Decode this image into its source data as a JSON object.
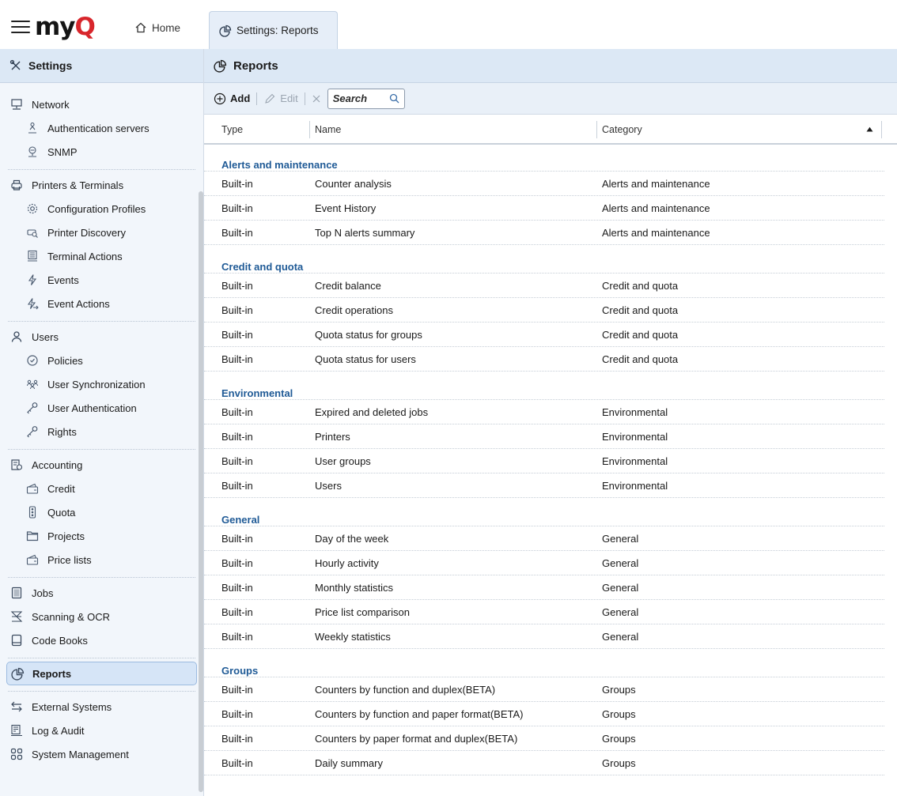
{
  "app": {
    "logo_text": "my",
    "logo_accent": "Q",
    "home_label": "Home",
    "tab_label": "Settings: Reports",
    "brand_color": "#d8262c"
  },
  "sidebar": {
    "title": "Settings",
    "sections": [
      {
        "items": [
          {
            "label": "Network",
            "icon": "network-icon",
            "level": "top"
          },
          {
            "label": "Authentication servers",
            "icon": "auth-server-icon",
            "level": "sub"
          },
          {
            "label": "SNMP",
            "icon": "snmp-icon",
            "level": "sub"
          }
        ]
      },
      {
        "items": [
          {
            "label": "Printers & Terminals",
            "icon": "printer-icon",
            "level": "top"
          },
          {
            "label": "Configuration Profiles",
            "icon": "gear-icon",
            "level": "sub"
          },
          {
            "label": "Printer Discovery",
            "icon": "discovery-icon",
            "level": "sub"
          },
          {
            "label": "Terminal Actions",
            "icon": "terminal-icon",
            "level": "sub"
          },
          {
            "label": "Events",
            "icon": "lightning-icon",
            "level": "sub"
          },
          {
            "label": "Event Actions",
            "icon": "lightning-arrow-icon",
            "level": "sub"
          }
        ]
      },
      {
        "items": [
          {
            "label": "Users",
            "icon": "user-icon",
            "level": "top"
          },
          {
            "label": "Policies",
            "icon": "shield-icon",
            "level": "sub"
          },
          {
            "label": "User Synchronization",
            "icon": "users-sync-icon",
            "level": "sub"
          },
          {
            "label": "User Authentication",
            "icon": "key-icon",
            "level": "sub"
          },
          {
            "label": "Rights",
            "icon": "key-icon",
            "level": "sub"
          }
        ]
      },
      {
        "items": [
          {
            "label": "Accounting",
            "icon": "accounting-icon",
            "level": "top"
          },
          {
            "label": "Credit",
            "icon": "wallet-icon",
            "level": "sub"
          },
          {
            "label": "Quota",
            "icon": "traffic-light-icon",
            "level": "sub"
          },
          {
            "label": "Projects",
            "icon": "folder-icon",
            "level": "sub"
          },
          {
            "label": "Price lists",
            "icon": "wallet-icon",
            "level": "sub"
          }
        ]
      },
      {
        "items": [
          {
            "label": "Jobs",
            "icon": "document-icon",
            "level": "top"
          },
          {
            "label": "Scanning & OCR",
            "icon": "scanner-icon",
            "level": "top"
          },
          {
            "label": "Code Books",
            "icon": "book-icon",
            "level": "top"
          }
        ]
      },
      {
        "items": [
          {
            "label": "Reports",
            "icon": "reports-icon",
            "level": "top",
            "selected": true
          }
        ]
      },
      {
        "items": [
          {
            "label": "External Systems",
            "icon": "exchange-icon",
            "level": "top"
          },
          {
            "label": "Log & Audit",
            "icon": "log-icon",
            "level": "top"
          },
          {
            "label": "System Management",
            "icon": "grid-icon",
            "level": "top"
          }
        ]
      }
    ]
  },
  "main": {
    "title": "Reports",
    "toolbar": {
      "add_label": "Add",
      "edit_label": "Edit",
      "search_placeholder": "Search"
    },
    "columns": {
      "type": "Type",
      "name": "Name",
      "category": "Category"
    },
    "groups": [
      {
        "title": "Alerts and maintenance",
        "rows": [
          {
            "type": "Built-in",
            "name": "Counter analysis",
            "category": "Alerts and maintenance"
          },
          {
            "type": "Built-in",
            "name": "Event History",
            "category": "Alerts and maintenance"
          },
          {
            "type": "Built-in",
            "name": "Top N alerts summary",
            "category": "Alerts and maintenance"
          }
        ]
      },
      {
        "title": "Credit and quota",
        "rows": [
          {
            "type": "Built-in",
            "name": "Credit balance",
            "category": "Credit and quota"
          },
          {
            "type": "Built-in",
            "name": "Credit operations",
            "category": "Credit and quota"
          },
          {
            "type": "Built-in",
            "name": "Quota status for groups",
            "category": "Credit and quota"
          },
          {
            "type": "Built-in",
            "name": "Quota status for users",
            "category": "Credit and quota"
          }
        ]
      },
      {
        "title": "Environmental",
        "rows": [
          {
            "type": "Built-in",
            "name": "Expired and deleted jobs",
            "category": "Environmental"
          },
          {
            "type": "Built-in",
            "name": "Printers",
            "category": "Environmental"
          },
          {
            "type": "Built-in",
            "name": "User groups",
            "category": "Environmental"
          },
          {
            "type": "Built-in",
            "name": "Users",
            "category": "Environmental"
          }
        ]
      },
      {
        "title": "General",
        "rows": [
          {
            "type": "Built-in",
            "name": "Day of the week",
            "category": "General"
          },
          {
            "type": "Built-in",
            "name": "Hourly activity",
            "category": "General"
          },
          {
            "type": "Built-in",
            "name": "Monthly statistics",
            "category": "General"
          },
          {
            "type": "Built-in",
            "name": "Price list comparison",
            "category": "General"
          },
          {
            "type": "Built-in",
            "name": "Weekly statistics",
            "category": "General"
          }
        ]
      },
      {
        "title": "Groups",
        "rows": [
          {
            "type": "Built-in",
            "name": "Counters by function and duplex(BETA)",
            "category": "Groups"
          },
          {
            "type": "Built-in",
            "name": "Counters by function and paper format(BETA)",
            "category": "Groups"
          },
          {
            "type": "Built-in",
            "name": "Counters by paper format and duplex(BETA)",
            "category": "Groups"
          },
          {
            "type": "Built-in",
            "name": "Daily summary",
            "category": "Groups"
          }
        ]
      }
    ]
  }
}
